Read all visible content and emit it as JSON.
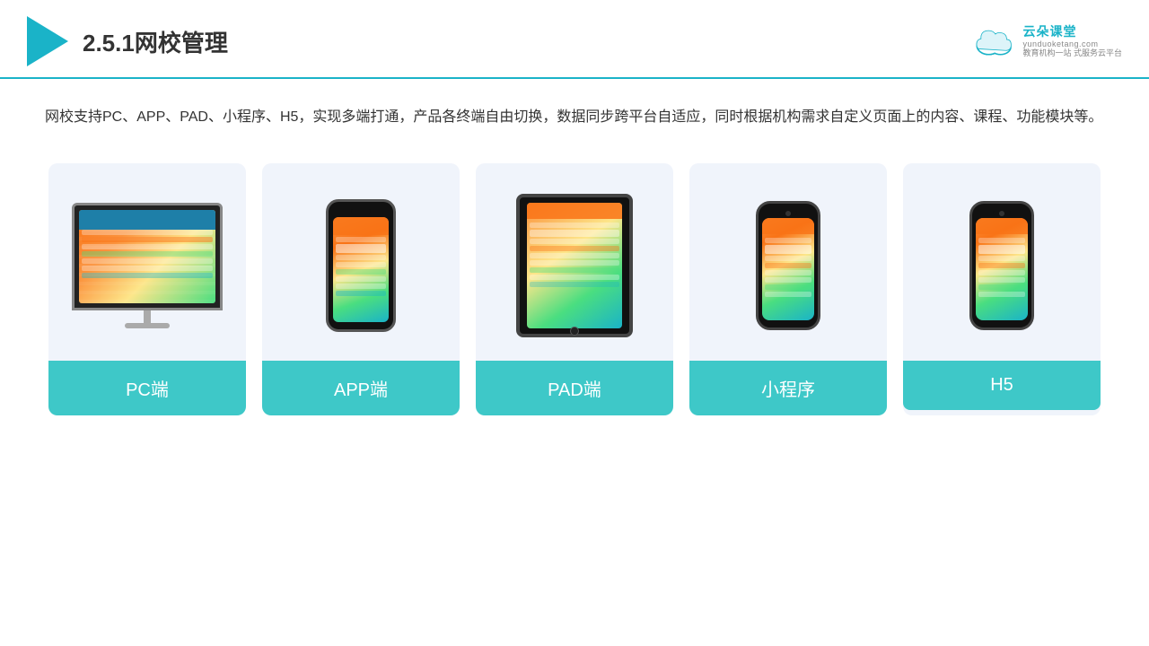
{
  "header": {
    "title": "2.5.1网校管理",
    "logo": {
      "main": "云朵课堂",
      "url": "yunduoketang.com",
      "tagline1": "教育机构一站",
      "tagline2": "式服务云平台"
    }
  },
  "description": "网校支持PC、APP、PAD、小程序、H5，实现多端打通，产品各终端自由切换，数据同步跨平台自适应，同时根据机构需求自定义页面上的内容、课程、功能模块等。",
  "cards": [
    {
      "id": "pc",
      "label": "PC端"
    },
    {
      "id": "app",
      "label": "APP端"
    },
    {
      "id": "pad",
      "label": "PAD端"
    },
    {
      "id": "miniprogram",
      "label": "小程序"
    },
    {
      "id": "h5",
      "label": "H5"
    }
  ],
  "accent_color": "#3ec8c8",
  "bg_color": "#f0f4fb"
}
